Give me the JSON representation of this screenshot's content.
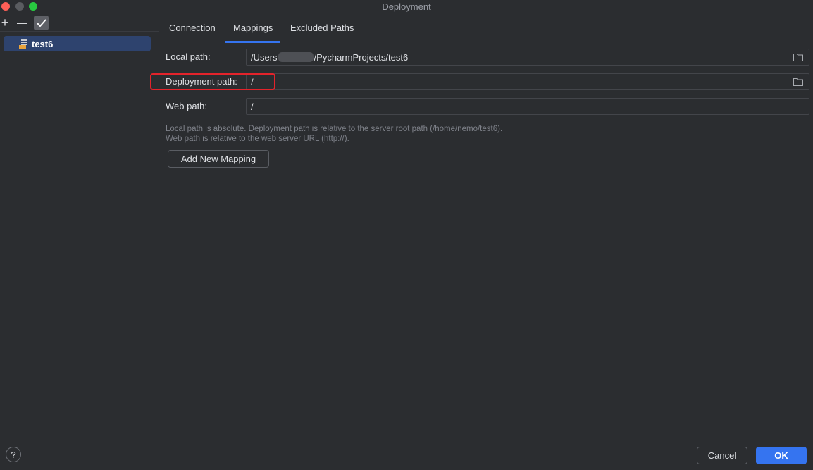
{
  "window": {
    "title": "Deployment"
  },
  "toolbar": {
    "add": "+",
    "remove": "—",
    "apply": "✔"
  },
  "servers": [
    {
      "name": "test6",
      "icon": "sftp-server-icon"
    }
  ],
  "tabs": [
    {
      "label": "Connection",
      "active": false
    },
    {
      "label": "Mappings",
      "active": true
    },
    {
      "label": "Excluded Paths",
      "active": false
    }
  ],
  "mappings": {
    "local_path_label": "Local path:",
    "local_path_prefix": "/Users",
    "local_path_suffix": "/PycharmProjects/test6",
    "deployment_path_label": "Deployment path:",
    "deployment_path_value": "/",
    "web_path_label": "Web path:",
    "web_path_value": "/",
    "help_line1": "Local path is absolute. Deployment path is relative to the server root path (/home/nemo/test6).",
    "help_line2": "Web path is relative to the web server URL (http://).",
    "add_button": "Add New Mapping"
  },
  "footer": {
    "help": "?",
    "cancel": "Cancel",
    "ok": "OK"
  },
  "colors": {
    "accent": "#3574f0",
    "highlight": "#e4232b",
    "selection": "#2e436e"
  }
}
